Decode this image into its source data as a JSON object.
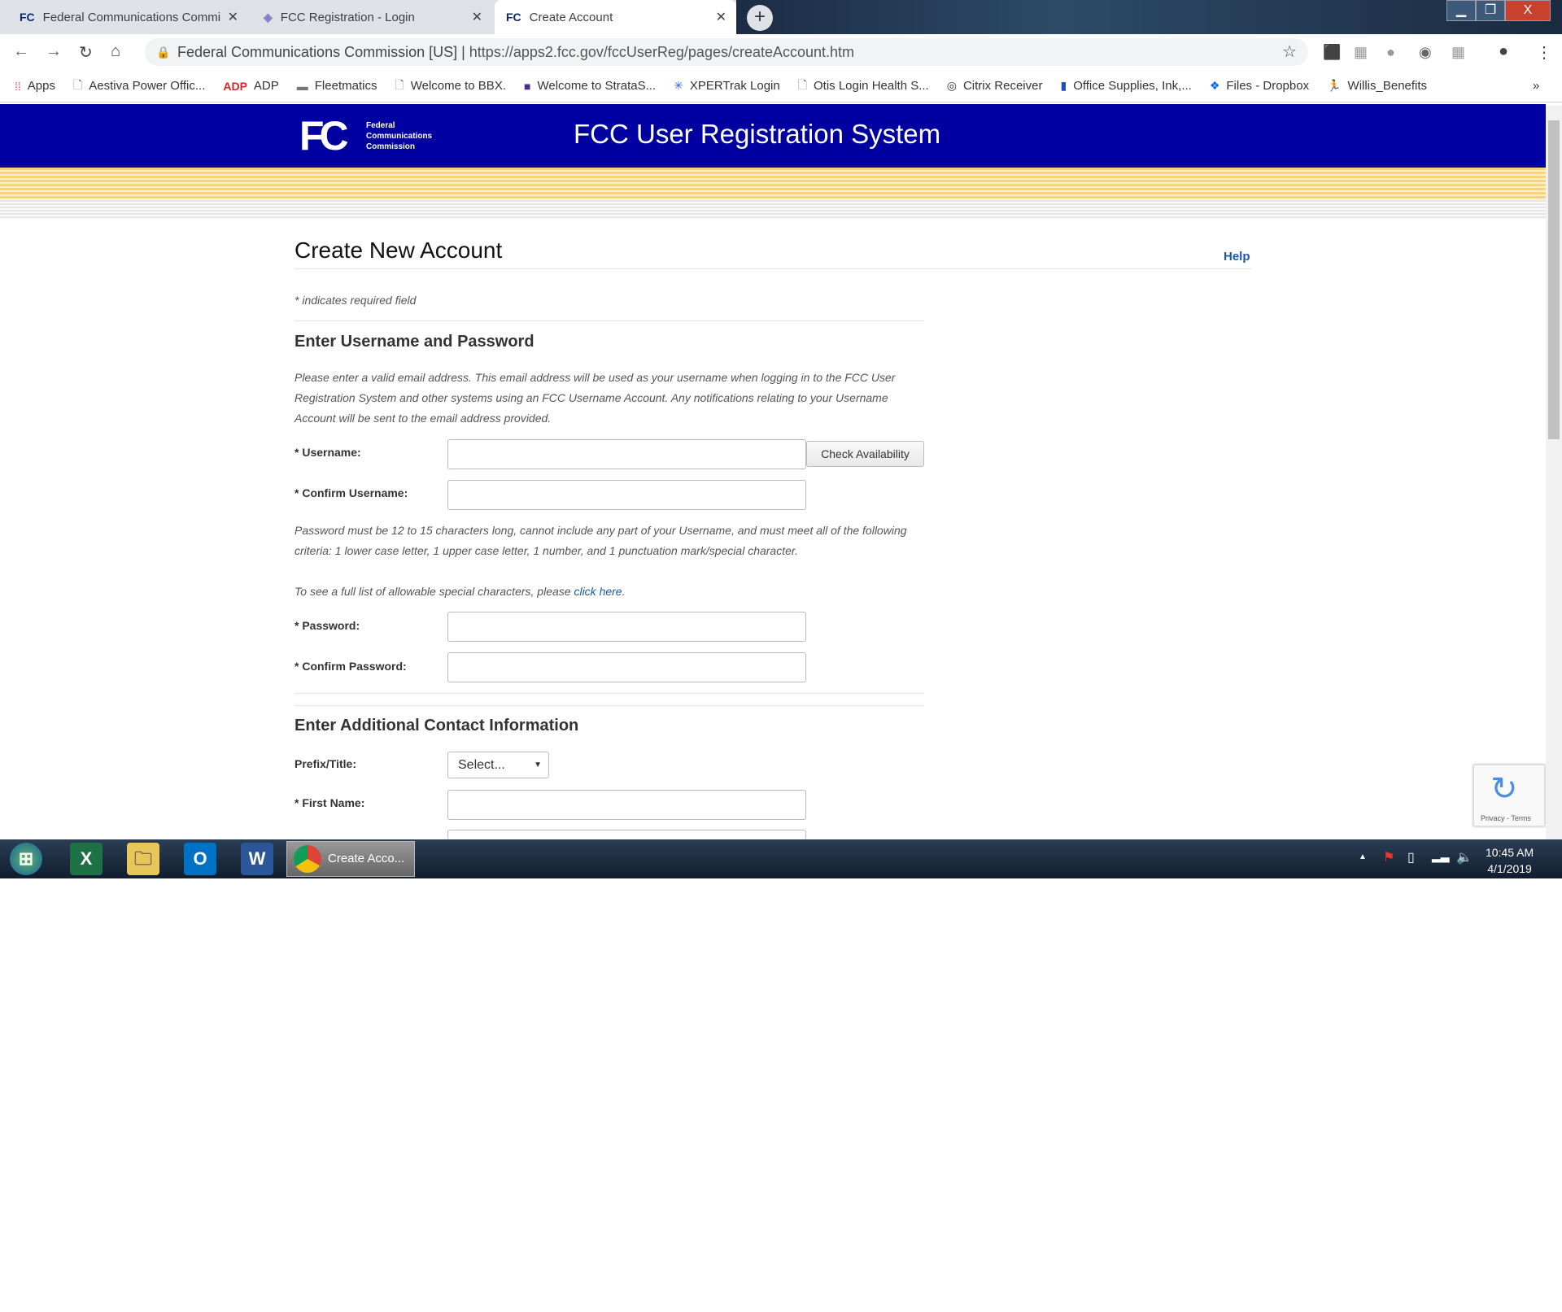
{
  "browser": {
    "tabs": [
      {
        "label": "Federal Communications Commi",
        "icon": "fcc-favicon"
      },
      {
        "label": "FCC Registration - Login",
        "icon": "diamond-favicon"
      },
      {
        "label": "Create Account",
        "icon": "fcc-favicon",
        "active": true
      }
    ],
    "address_site": "Federal Communications Commission [US]",
    "address_url": "https://apps2.fcc.gov/fccUserReg/pages/createAccount.htm",
    "bookmarks": [
      "Apps",
      "Aestiva Power Offic...",
      "ADP",
      "Fleetmatics",
      "Welcome to BBX.",
      "Welcome to StrataS...",
      "XPERTrak Login",
      "Otis Login Health S...",
      "Citrix Receiver",
      "Office Supplies, Ink,...",
      "Files - Dropbox",
      "Willis_Benefits"
    ],
    "more": "»"
  },
  "header": {
    "logo_text": "FCC",
    "logo_sub": [
      "Federal",
      "Communications",
      "Commission"
    ],
    "title": "FCC User Registration System",
    "bg": "#0000a0"
  },
  "page": {
    "title": "Create New Account",
    "help": "Help",
    "required_note": "* indicates required field",
    "section1": {
      "heading": "Enter Username and Password",
      "intro": "Please enter a valid email address. This email address will be used as your username when logging in to the FCC User Registration System and other systems using an FCC Username Account. Any notifications relating to your Username Account will be sent to the email address provided.",
      "username_label": "* Username:",
      "username_value": "",
      "check_button": "Check Availability",
      "confirm_username_label": "* Confirm Username:",
      "confirm_username_value": "",
      "password_rules": "Password must be 12 to 15 characters long, cannot include any part of your Username, and must meet all of the following criteria: 1 lower case letter, 1 upper case letter, 1 number, and 1 punctuation mark/special character.",
      "special_prefix": "To see a full list of allowable special characters, please ",
      "special_link": "click here",
      "special_suffix": ".",
      "password_label": "* Password:",
      "confirm_password_label": "* Confirm Password:"
    },
    "section2": {
      "heading": "Enter Additional Contact Information",
      "prefix_label": "Prefix/Title:",
      "prefix_value": "Select...",
      "first_name_label": "* First Name:"
    },
    "recaptcha": "Privacy - Terms"
  },
  "taskbar": {
    "active_window": "Create Acco...",
    "time": "10:45 AM",
    "date": "4/1/2019"
  }
}
